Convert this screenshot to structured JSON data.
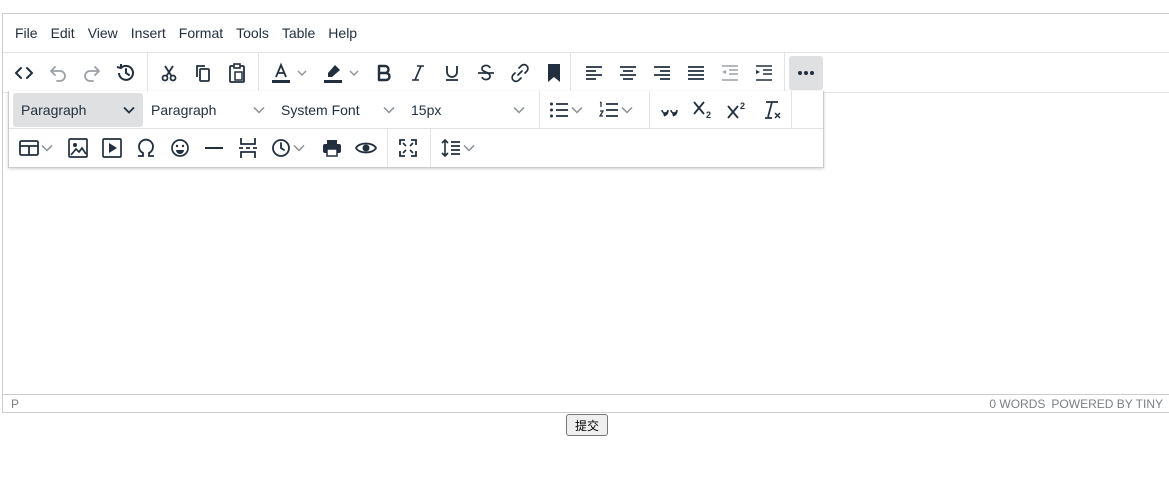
{
  "menubar": [
    "File",
    "Edit",
    "View",
    "Insert",
    "Format",
    "Tools",
    "Table",
    "Help"
  ],
  "toolbar": {
    "row1_icons": [
      "source-code-icon",
      "undo-icon",
      "redo-icon",
      "restore-draft-icon",
      "cut-icon",
      "copy-icon",
      "paste-icon",
      "text-color-icon",
      "highlight-color-icon",
      "bold-icon",
      "italic-icon",
      "underline-icon",
      "strikethrough-icon",
      "link-icon",
      "bookmark-icon",
      "align-left-icon",
      "align-center-icon",
      "align-right-icon",
      "align-justify-icon",
      "outdent-icon",
      "indent-icon",
      "more-icon"
    ],
    "text_color_accent": "#222f3e"
  },
  "overflow": {
    "block_format": "Paragraph",
    "paragraph_style": "Paragraph",
    "font_family": "System Font",
    "font_size": "15px",
    "row2_icons": [
      "table-icon",
      "image-icon",
      "media-icon",
      "special-char-icon",
      "emoji-icon",
      "horizontal-rule-icon",
      "page-break-icon",
      "insert-datetime-icon",
      "print-icon",
      "preview-icon",
      "fullscreen-icon",
      "line-height-icon"
    ]
  },
  "statusbar": {
    "path": "P",
    "word_count": "0 WORDS",
    "branding": "POWERED BY TINY"
  },
  "submit_label": "提交",
  "colors": {
    "border": "#cccccc",
    "active_bg": "#dee0e2",
    "icon": "#222f3e"
  }
}
